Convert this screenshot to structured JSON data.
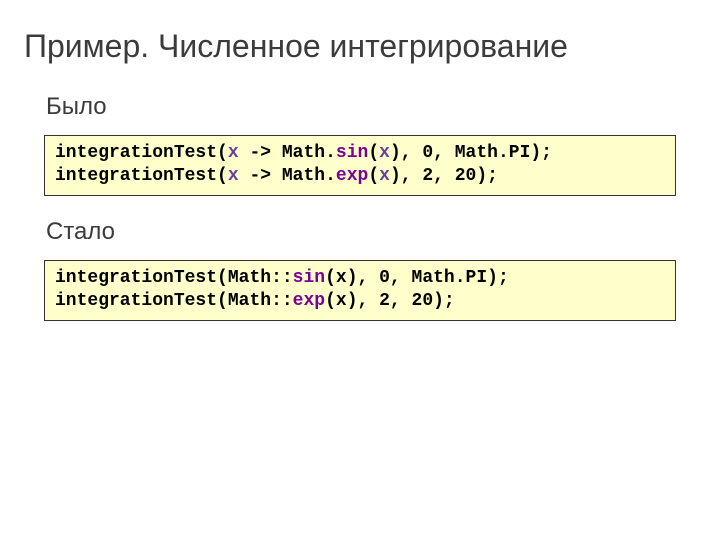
{
  "title": "Пример. Численное интегрирование",
  "before": {
    "label": "Было",
    "code": {
      "l1": {
        "fn": "integrationTest",
        "open": "(",
        "lam_x1": "x",
        "arrow": " -> ",
        "cls": "Math",
        "dot": ".",
        "method": "sin",
        "po": "(",
        "lam_x2": "x",
        "pc": ")",
        "rest": ", 0, Math.PI);"
      },
      "l2": {
        "fn": "integrationTest",
        "open": "(",
        "lam_x1": "x",
        "arrow": " -> ",
        "cls": "Math",
        "dot": ".",
        "method": "exp",
        "po": "(",
        "lam_x2": "x",
        "pc": ")",
        "rest": ", 2, 20);"
      }
    }
  },
  "after": {
    "label": "Стало",
    "code": {
      "l1": {
        "fn": "integrationTest",
        "open": "(",
        "cls": "Math",
        "ref": "::",
        "method": "sin",
        "po": "(",
        "arg": "x",
        "pc": ")",
        "rest": ", 0, Math.PI);"
      },
      "l2": {
        "fn": "integrationTest",
        "open": "(",
        "cls": "Math",
        "ref": "::",
        "method": "exp",
        "po": "(",
        "arg": "x",
        "pc": ")",
        "rest": ", 2, 20);"
      }
    }
  }
}
